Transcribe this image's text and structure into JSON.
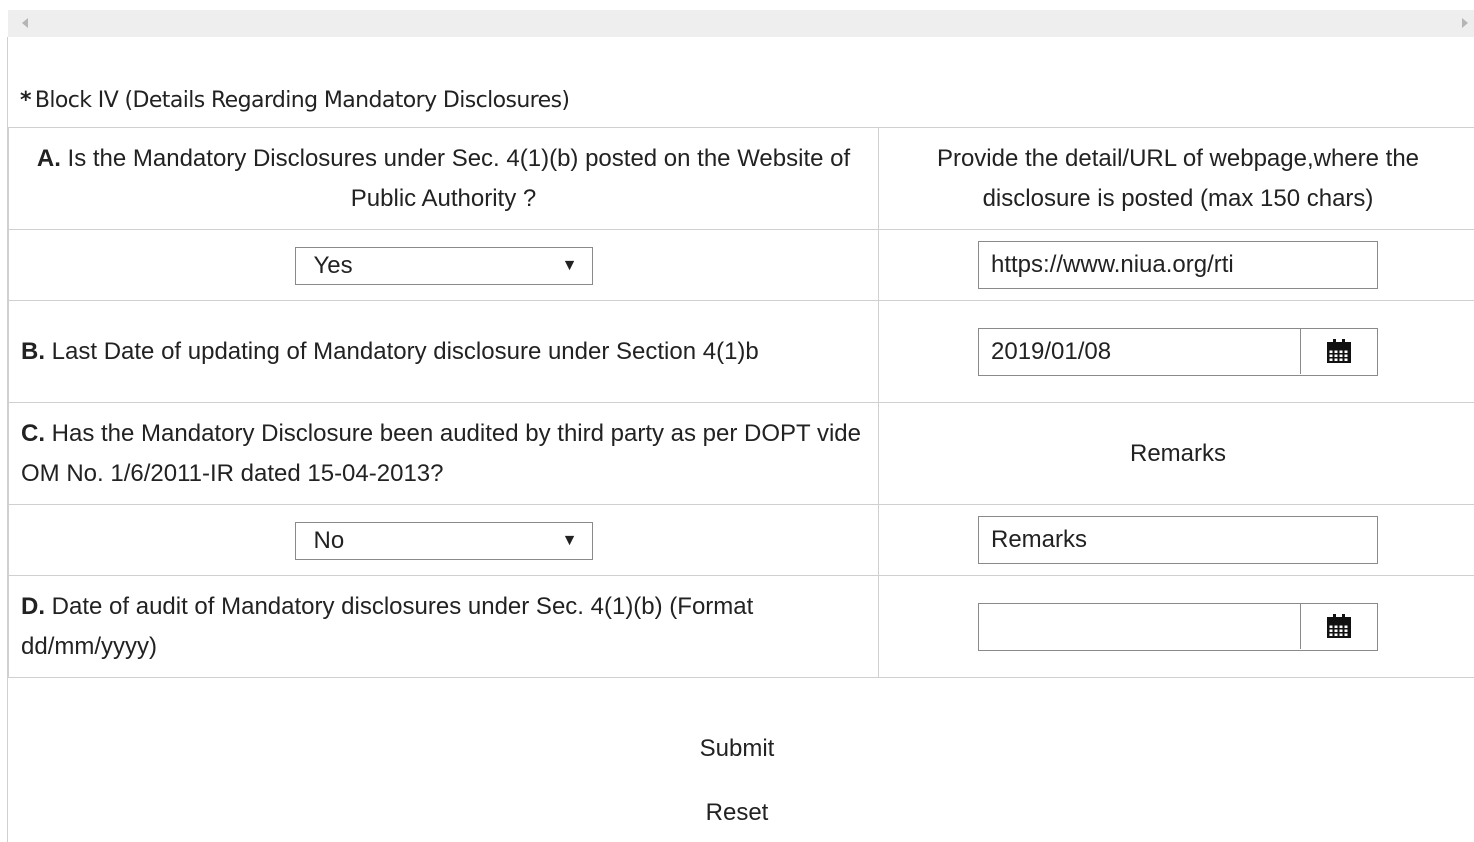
{
  "block": {
    "star": "*",
    "title": "Block IV (Details Regarding Mandatory Disclosures)"
  },
  "rowA": {
    "letter": "A.",
    "question": " Is the Mandatory Disclosures under Sec. 4(1)(b) posted on the Website of Public Authority ?",
    "url_header": "Provide the detail/URL of webpage,where the disclosure is posted (max 150 chars)",
    "select_value": "Yes",
    "url_value": "https://www.niua.org/rti"
  },
  "rowB": {
    "letter": "B.",
    "question": " Last Date of updating of Mandatory disclosure under Section 4(1)b",
    "date_value": "2019/01/08"
  },
  "rowC": {
    "letter": "C.",
    "question": " Has the Mandatory Disclosure been audited by third party as per DOPT vide OM No. 1/6/2011-IR dated 15-04-2013?",
    "remarks_header": "Remarks",
    "select_value": "No",
    "remarks_value": "Remarks"
  },
  "rowD": {
    "letter": "D.",
    "question": " Date of audit of Mandatory disclosures under Sec. 4(1)(b) (Format dd/mm/yyyy)",
    "date_value": ""
  },
  "actions": {
    "submit": "Submit",
    "reset": "Reset"
  },
  "icons": {
    "dropdown": "caret-down-icon",
    "calendar": "calendar-icon",
    "scroll_left": "scroll-left-arrow-icon",
    "scroll_right": "scroll-right-arrow-icon"
  }
}
